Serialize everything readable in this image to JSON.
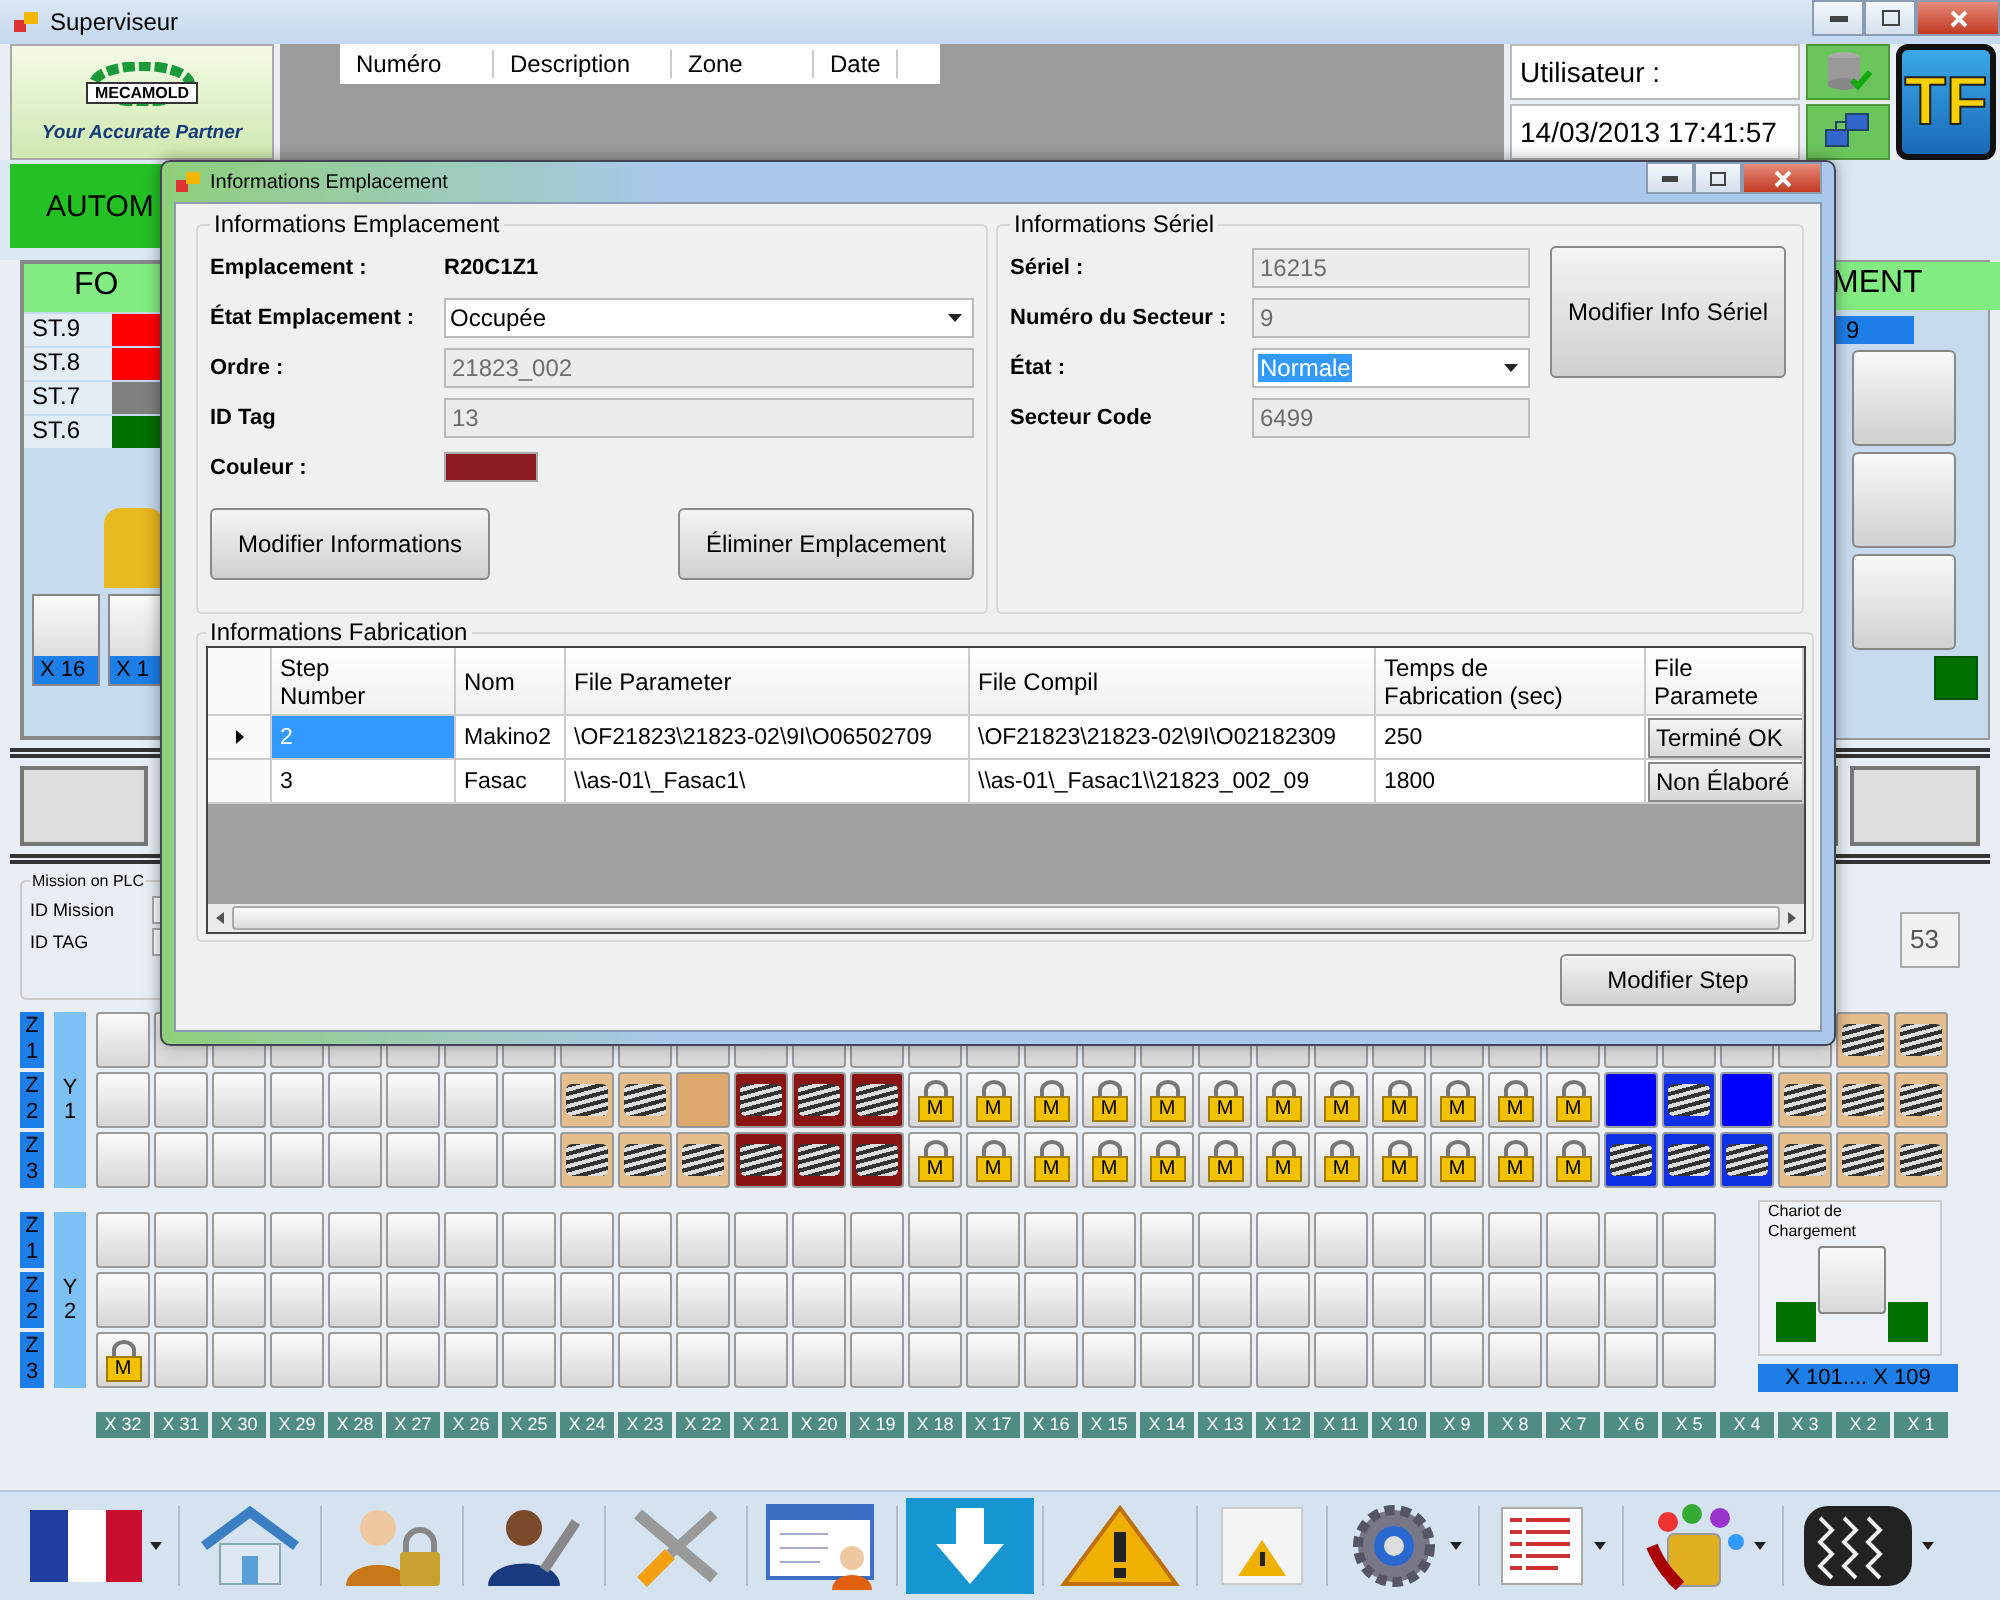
{
  "app": {
    "title": "Superviseur"
  },
  "header": {
    "logo_name": "MECAMOLD",
    "logo_tagline": "Your Accurate Partner",
    "columns": [
      "Numéro",
      "Description",
      "Zone",
      "Date"
    ],
    "user_label": "Utilisateur :",
    "datetime": "14/03/2013 17:41:57",
    "brand": "TF"
  },
  "mode_banner": "AUTOM",
  "left_panel": {
    "title": "FO",
    "stations": [
      {
        "name": "ST.9",
        "color": "#ff0000"
      },
      {
        "name": "ST.8",
        "color": "#ff0000"
      },
      {
        "name": "ST.7",
        "color": "#808080"
      },
      {
        "name": "ST.6",
        "color": "#007000"
      }
    ],
    "positions": [
      "X 16",
      "X 1"
    ]
  },
  "right_panel": {
    "title": "MENT",
    "station": "9"
  },
  "mission": {
    "title": "Mission on PLC",
    "fields": [
      "ID Mission",
      "ID TAG"
    ],
    "counter": "53"
  },
  "grid": {
    "blocks": [
      {
        "label": "Y 1",
        "rows": [
          {
            "label": "Z 1",
            "cells": [
              {
                "kind": "empty"
              },
              {
                "kind": "empty"
              },
              {
                "kind": "empty"
              },
              {
                "kind": "empty"
              },
              {
                "kind": "empty"
              },
              {
                "kind": "empty"
              },
              {
                "kind": "empty"
              },
              {
                "kind": "empty"
              },
              {
                "kind": "empty"
              },
              {
                "kind": "empty"
              },
              {
                "kind": "empty"
              },
              {
                "kind": "empty"
              },
              {
                "kind": "empty"
              },
              {
                "kind": "empty"
              },
              {
                "kind": "empty"
              },
              {
                "kind": "empty"
              },
              {
                "kind": "empty"
              },
              {
                "kind": "empty"
              },
              {
                "kind": "empty"
              },
              {
                "kind": "empty"
              },
              {
                "kind": "empty"
              },
              {
                "kind": "empty"
              },
              {
                "kind": "empty"
              },
              {
                "kind": "empty"
              },
              {
                "kind": "empty"
              },
              {
                "kind": "empty"
              },
              {
                "kind": "empty"
              },
              {
                "kind": "empty"
              },
              {
                "kind": "empty"
              },
              {
                "kind": "empty"
              },
              {
                "kind": "coil-tan"
              },
              {
                "kind": "coil-tan"
              }
            ]
          },
          {
            "label": "Z 2",
            "cells": [
              {
                "kind": "empty"
              },
              {
                "kind": "empty"
              },
              {
                "kind": "empty"
              },
              {
                "kind": "empty"
              },
              {
                "kind": "empty"
              },
              {
                "kind": "empty"
              },
              {
                "kind": "empty"
              },
              {
                "kind": "empty"
              },
              {
                "kind": "coil-tan"
              },
              {
                "kind": "coil-tan"
              },
              {
                "kind": "tan"
              },
              {
                "kind": "coil-red"
              },
              {
                "kind": "coil-red"
              },
              {
                "kind": "coil-red"
              },
              {
                "kind": "lock",
                "label": "M"
              },
              {
                "kind": "lock",
                "label": "M"
              },
              {
                "kind": "lock",
                "label": "M"
              },
              {
                "kind": "lock",
                "label": "M"
              },
              {
                "kind": "lock",
                "label": "M"
              },
              {
                "kind": "lock",
                "label": "M"
              },
              {
                "kind": "lock",
                "label": "M"
              },
              {
                "kind": "lock",
                "label": "M"
              },
              {
                "kind": "lock",
                "label": "M"
              },
              {
                "kind": "lock",
                "label": "M"
              },
              {
                "kind": "lock",
                "label": "M"
              },
              {
                "kind": "lock",
                "label": "M"
              },
              {
                "kind": "blue"
              },
              {
                "kind": "coil-blue"
              },
              {
                "kind": "blue"
              },
              {
                "kind": "coil-tan"
              },
              {
                "kind": "coil-tan"
              },
              {
                "kind": "coil-tan"
              }
            ]
          },
          {
            "label": "Z 3",
            "cells": [
              {
                "kind": "empty"
              },
              {
                "kind": "empty"
              },
              {
                "kind": "empty"
              },
              {
                "kind": "empty"
              },
              {
                "kind": "empty"
              },
              {
                "kind": "empty"
              },
              {
                "kind": "empty"
              },
              {
                "kind": "empty"
              },
              {
                "kind": "coil-tan"
              },
              {
                "kind": "coil-tan"
              },
              {
                "kind": "coil-tan"
              },
              {
                "kind": "coil-red"
              },
              {
                "kind": "coil-red"
              },
              {
                "kind": "coil-red"
              },
              {
                "kind": "lock",
                "label": "M"
              },
              {
                "kind": "lock",
                "label": "M"
              },
              {
                "kind": "lock",
                "label": "M"
              },
              {
                "kind": "lock",
                "label": "M"
              },
              {
                "kind": "lock",
                "label": "M"
              },
              {
                "kind": "lock",
                "label": "M"
              },
              {
                "kind": "lock",
                "label": "M"
              },
              {
                "kind": "lock",
                "label": "M"
              },
              {
                "kind": "lock",
                "label": "M"
              },
              {
                "kind": "lock",
                "label": "M"
              },
              {
                "kind": "lock",
                "label": "M"
              },
              {
                "kind": "lock",
                "label": "M"
              },
              {
                "kind": "coil-blue"
              },
              {
                "kind": "coil-blue"
              },
              {
                "kind": "coil-blue"
              },
              {
                "kind": "coil-tan"
              },
              {
                "kind": "coil-tan"
              },
              {
                "kind": "coil-tan"
              }
            ]
          }
        ]
      },
      {
        "label": "Y 2",
        "rows": [
          {
            "label": "Z 1",
            "cells": [
              {
                "kind": "empty"
              },
              {
                "kind": "empty"
              },
              {
                "kind": "empty"
              },
              {
                "kind": "empty"
              },
              {
                "kind": "empty"
              },
              {
                "kind": "empty"
              },
              {
                "kind": "empty"
              },
              {
                "kind": "empty"
              },
              {
                "kind": "empty"
              },
              {
                "kind": "empty"
              },
              {
                "kind": "empty"
              },
              {
                "kind": "empty"
              },
              {
                "kind": "empty"
              },
              {
                "kind": "empty"
              },
              {
                "kind": "empty"
              },
              {
                "kind": "empty"
              },
              {
                "kind": "empty"
              },
              {
                "kind": "empty"
              },
              {
                "kind": "empty"
              },
              {
                "kind": "empty"
              },
              {
                "kind": "empty"
              },
              {
                "kind": "empty"
              },
              {
                "kind": "empty"
              },
              {
                "kind": "empty"
              },
              {
                "kind": "empty"
              },
              {
                "kind": "empty"
              },
              {
                "kind": "empty"
              },
              {
                "kind": "empty"
              }
            ]
          },
          {
            "label": "Z 2",
            "cells": [
              {
                "kind": "empty"
              },
              {
                "kind": "empty"
              },
              {
                "kind": "empty"
              },
              {
                "kind": "empty"
              },
              {
                "kind": "empty"
              },
              {
                "kind": "empty"
              },
              {
                "kind": "empty"
              },
              {
                "kind": "empty"
              },
              {
                "kind": "empty"
              },
              {
                "kind": "empty"
              },
              {
                "kind": "empty"
              },
              {
                "kind": "empty"
              },
              {
                "kind": "empty"
              },
              {
                "kind": "empty"
              },
              {
                "kind": "empty"
              },
              {
                "kind": "empty"
              },
              {
                "kind": "empty"
              },
              {
                "kind": "empty"
              },
              {
                "kind": "empty"
              },
              {
                "kind": "empty"
              },
              {
                "kind": "empty"
              },
              {
                "kind": "empty"
              },
              {
                "kind": "empty"
              },
              {
                "kind": "empty"
              },
              {
                "kind": "empty"
              },
              {
                "kind": "empty"
              },
              {
                "kind": "empty"
              },
              {
                "kind": "empty"
              }
            ]
          },
          {
            "label": "Z 3",
            "cells": [
              {
                "kind": "lock",
                "label": "M"
              },
              {
                "kind": "empty"
              },
              {
                "kind": "empty"
              },
              {
                "kind": "empty"
              },
              {
                "kind": "empty"
              },
              {
                "kind": "empty"
              },
              {
                "kind": "empty"
              },
              {
                "kind": "empty"
              },
              {
                "kind": "empty"
              },
              {
                "kind": "empty"
              },
              {
                "kind": "empty"
              },
              {
                "kind": "empty"
              },
              {
                "kind": "empty"
              },
              {
                "kind": "empty"
              },
              {
                "kind": "empty"
              },
              {
                "kind": "empty"
              },
              {
                "kind": "empty"
              },
              {
                "kind": "empty"
              },
              {
                "kind": "empty"
              },
              {
                "kind": "empty"
              },
              {
                "kind": "empty"
              },
              {
                "kind": "empty"
              },
              {
                "kind": "empty"
              },
              {
                "kind": "empty"
              },
              {
                "kind": "empty"
              },
              {
                "kind": "empty"
              },
              {
                "kind": "empty"
              },
              {
                "kind": "empty"
              }
            ]
          }
        ]
      }
    ],
    "x_labels": [
      "X 32",
      "X 31",
      "X 30",
      "X 29",
      "X 28",
      "X 27",
      "X 26",
      "X 25",
      "X 24",
      "X 23",
      "X 22",
      "X 21",
      "X 20",
      "X 19",
      "X 18",
      "X 17",
      "X 16",
      "X 15",
      "X 14",
      "X 13",
      "X 12",
      "X 11",
      "X 10",
      "X 9",
      "X 8",
      "X 7",
      "X 6",
      "X 5",
      "X 4",
      "X 3",
      "X 2",
      "X 1"
    ]
  },
  "chariot": {
    "title": "Chariot de Chargement",
    "range": "X 101.... X 109"
  },
  "toolbar": [
    {
      "kind": "flag",
      "selected": false,
      "dropdown": true
    },
    {
      "kind": "home",
      "selected": false,
      "dropdown": false
    },
    {
      "kind": "user-lock",
      "selected": false,
      "dropdown": false
    },
    {
      "kind": "user-wrench",
      "selected": false,
      "dropdown": false
    },
    {
      "kind": "tools",
      "selected": false,
      "dropdown": false
    },
    {
      "kind": "card",
      "selected": false,
      "dropdown": false
    },
    {
      "kind": "download",
      "selected": true,
      "dropdown": false
    },
    {
      "kind": "warning",
      "selected": false,
      "dropdown": false
    },
    {
      "kind": "note",
      "selected": false,
      "dropdown": false
    },
    {
      "kind": "gear",
      "selected": false,
      "dropdown": true
    },
    {
      "kind": "log",
      "selected": false,
      "dropdown": true
    },
    {
      "kind": "paint",
      "selected": false,
      "dropdown": true
    },
    {
      "kind": "tire",
      "selected": false,
      "dropdown": true
    }
  ],
  "dialog": {
    "title": "Informations Emplacement",
    "location": {
      "title": "Informations Emplacement",
      "fields": [
        {
          "kind": "value",
          "label": "Emplacement :",
          "value": "R20C1Z1"
        },
        {
          "kind": "combo",
          "label": "État Emplacement :",
          "value": "Occupée",
          "highlighted": false
        },
        {
          "kind": "readonly",
          "label": "Ordre :",
          "value": "21823_002",
          "disabled": true
        },
        {
          "kind": "readonly",
          "label": "ID Tag",
          "value": "13",
          "disabled": true
        },
        {
          "kind": "swatch",
          "label": "Couleur :",
          "color": "#8b1a1f"
        }
      ],
      "buttons": [
        "Modifier Informations",
        "Éliminer Emplacement"
      ]
    },
    "serial": {
      "title": "Informations Sériel",
      "fields": [
        {
          "kind": "readonly",
          "label": "Sériel :",
          "value": "16215",
          "disabled": true
        },
        {
          "kind": "readonly",
          "label": "Numéro du Secteur :",
          "value": "9",
          "disabled": true
        },
        {
          "kind": "combo",
          "label": "État :",
          "value": "Normale",
          "highlighted": true
        },
        {
          "kind": "readonly",
          "label": "Secteur Code",
          "value": "6499",
          "disabled": true
        }
      ],
      "button": "Modifier Info Sériel"
    },
    "fabrication": {
      "title": "Informations Fabrication",
      "columns": [
        "Step Number",
        "Nom",
        "File Parameter",
        "File Compil",
        "Temps de Fabrication (sec)",
        "File Paramete"
      ],
      "rows": [
        {
          "selected": true,
          "cells": [
            "2",
            "Makino2",
            "\\OF21823\\21823-02\\9I\\O06502709",
            "\\OF21823\\21823-02\\9I\\O02182309",
            "250"
          ],
          "status": "Terminé OK"
        },
        {
          "selected": false,
          "cells": [
            "3",
            "Fasac",
            "\\\\as-01\\_Fasac1\\",
            "\\\\as-01\\_Fasac1\\\\21823_002_09",
            "1800"
          ],
          "status": "Non Élaboré"
        }
      ]
    },
    "footer_button": "Modifier Step"
  }
}
